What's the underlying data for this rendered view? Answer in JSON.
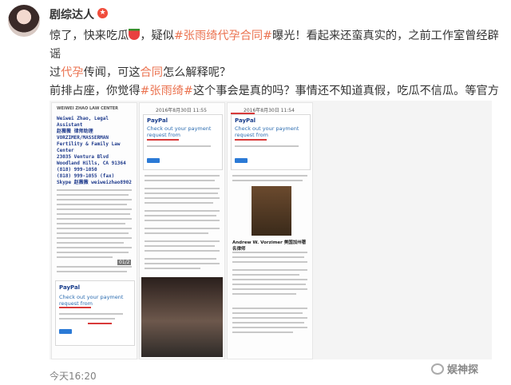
{
  "user": {
    "name": "剧综达人",
    "badge": "★"
  },
  "post": {
    "l1_a": "惊了，快来吃瓜",
    "l1_b": "，疑似",
    "l1_tag": "#张雨绮代孕合同#",
    "l1_c": "曝光！看起来还蛮真实的，之前工作室曾经辟谣",
    "l2_a": "过",
    "l2_kw1": "代孕",
    "l2_b": "传闻，可这",
    "l2_kw2": "合同",
    "l2_c": "怎么解释呢？",
    "l3_a": "前排占座，你觉得",
    "l3_tag": "#张雨绮#",
    "l3_b": "这个事会是真的吗？事情还不知道真假，吃瓜不信瓜。等官方回应～"
  },
  "images": {
    "card1": {
      "header": "WEIWEI ZHAO LAW CENTER",
      "address": [
        "Weiwei Zhao, Legal Assistant",
        "赵薇薇 律师助理",
        "VORZIMER/MASSERMAN",
        "Fertility & Family Law Center",
        "23035 Ventura Blvd",
        "Woodland Hills, CA 91364",
        "(818) 999-1050",
        "(818) 999-1055 (fax)",
        "Skype 赵薇薇  weiweizhao8902"
      ],
      "page_badge": "01/2"
    },
    "card2": {
      "date": "2016年8月30日 11:55"
    },
    "card3": {
      "date": "2016年8月30日 11:54"
    },
    "paypal_label": "PayPal",
    "payment_title": "Check out your payment request from",
    "man_caption": "Andrew W. Vorzimer 美国加州著名律师"
  },
  "footer": {
    "time": "今天16:20",
    "brand": "娱神探"
  }
}
